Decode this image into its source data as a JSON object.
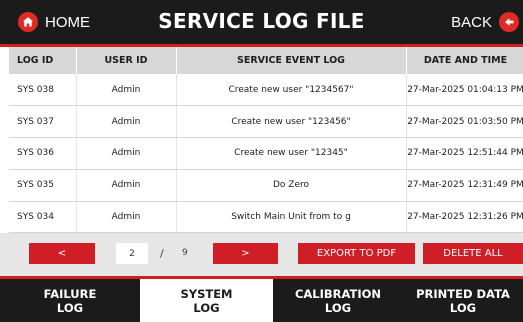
{
  "header": {
    "home_label": "HOME",
    "title": "SERVICE LOG FILE",
    "back_label": "BACK"
  },
  "table": {
    "columns": [
      "LOG ID",
      "USER ID",
      "SERVICE EVENT LOG",
      "DATE AND TIME"
    ],
    "rows": [
      [
        "SYS 038",
        "Admin",
        "Create new user \"1234567\"",
        "27-Mar-2025 01:04:13 PM"
      ],
      [
        "SYS 037",
        "Admin",
        "Create new user \"123456\"",
        "27-Mar-2025 01:03:50 PM"
      ],
      [
        "SYS 036",
        "Admin",
        "Create new user \"12345\"",
        "27-Mar-2025 12:51:44 PM"
      ],
      [
        "SYS 035",
        "Admin",
        "Do Zero",
        "27-Mar-2025 12:31:49 PM"
      ],
      [
        "SYS 034",
        "Admin",
        "Switch Main Unit from  to g",
        "27-Mar-2025 12:31:26 PM"
      ]
    ]
  },
  "pagination": {
    "prev_label": "<",
    "current_page": "2",
    "separator": "/",
    "total_pages": "9",
    "next_label": ">"
  },
  "actions": {
    "export_label": "EXPORT TO PDF",
    "delete_label": "DELETE ALL"
  },
  "tabs": [
    {
      "label": "FAILURE\nLOG",
      "active": false
    },
    {
      "label": "SYSTEM\nLOG",
      "active": true
    },
    {
      "label": "CALIBRATION\nLOG",
      "active": false
    },
    {
      "label": "PRINTED DATA\nLOG",
      "active": false
    }
  ],
  "colors": {
    "accent": "#d01e26",
    "header_bg": "#1b1b1b",
    "table_header_bg": "#d7d7d7",
    "control_bar_bg": "#e6e6e6"
  },
  "icons": {
    "home": "home-icon",
    "back": "back-arrow-icon"
  }
}
